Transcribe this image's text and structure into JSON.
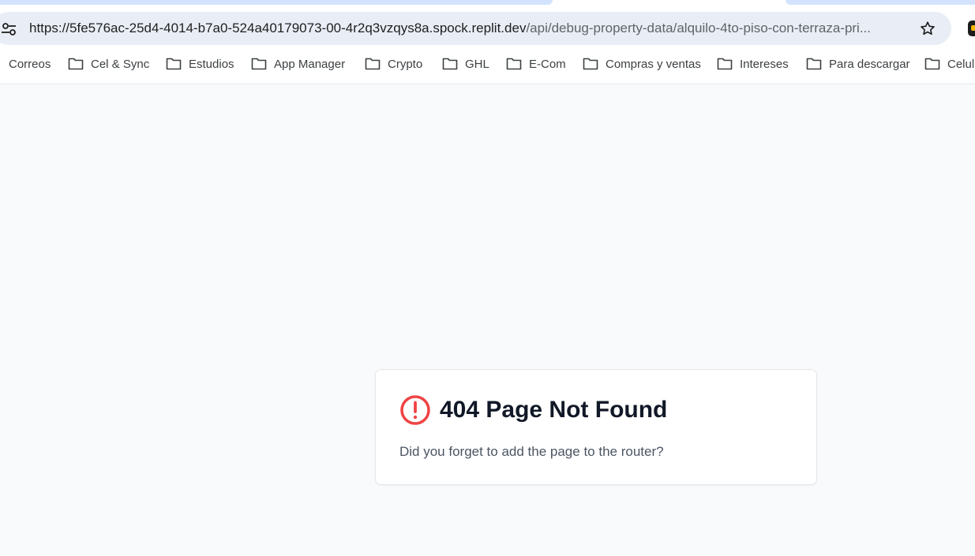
{
  "browser": {
    "url_host": "https://5fe576ac-25d4-4014-b7a0-524a40179073-00-4r2q3vzqys8a.spock.replit.dev",
    "url_path": "/api/debug-property-data/alquilo-4to-piso-con-terraza-pri...",
    "site_info_icon": "tune-icon",
    "bookmark_icon": "star-outline-icon"
  },
  "bookmarks": [
    {
      "label": "Correos"
    },
    {
      "label": "Cel & Sync"
    },
    {
      "label": "Estudios"
    },
    {
      "label": "App Manager"
    },
    {
      "label": "Crypto"
    },
    {
      "label": "GHL"
    },
    {
      "label": "E-Com"
    },
    {
      "label": "Compras y ventas"
    },
    {
      "label": "Intereses"
    },
    {
      "label": "Para descargar"
    },
    {
      "label": "Celul"
    }
  ],
  "error_card": {
    "icon": "alert-circle-icon",
    "icon_color": "#ef4444",
    "title": "404 Page Not Found",
    "message": "Did you forget to add the page to the router?"
  }
}
